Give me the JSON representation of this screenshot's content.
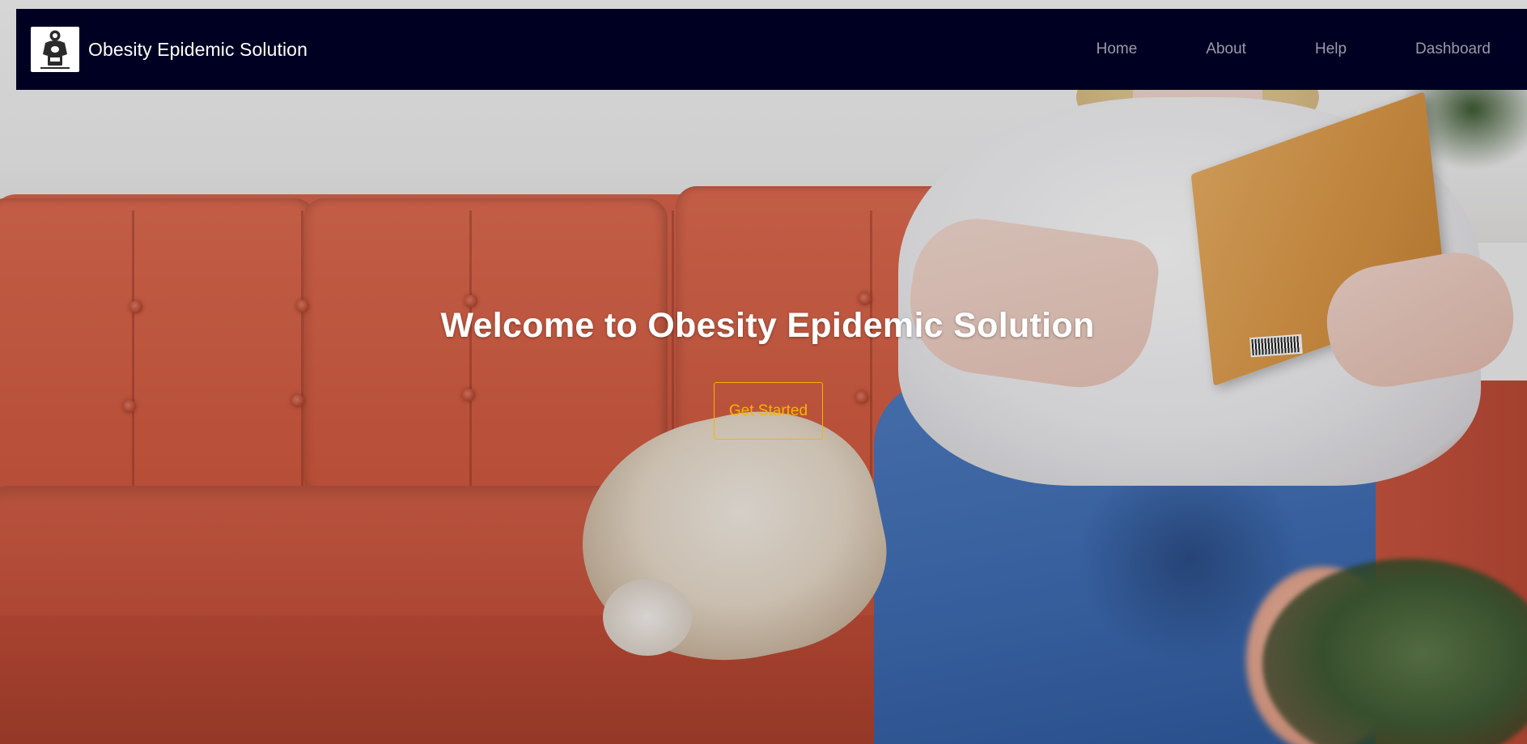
{
  "navbar": {
    "brand_name": "Obesity Epidemic Solution",
    "logo_icon": "scale-figure-logo-icon",
    "links": [
      {
        "label": "Home"
      },
      {
        "label": "About"
      },
      {
        "label": "Help"
      },
      {
        "label": "Dashboard"
      }
    ]
  },
  "hero": {
    "title": "Welcome to Obesity Epidemic Solution",
    "cta_label": "Get Started",
    "background_image": "woman-reading-on-red-sofa-with-dog"
  },
  "colors": {
    "navbar_bg": "#000022",
    "nav_link": "#9a9aab",
    "brand_text": "#ffffff",
    "cta_accent": "#f5b400",
    "sofa": "#d0593f",
    "jeans": "#3f6db3"
  }
}
